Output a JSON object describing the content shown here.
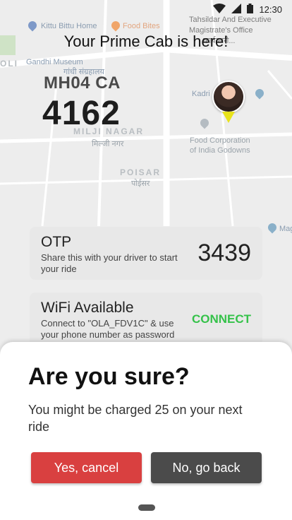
{
  "status_bar": {
    "time": "12:30",
    "icons": [
      "wifi-icon",
      "signal-icon",
      "battery-icon"
    ]
  },
  "map": {
    "labels": {
      "kittu_bittu_home": "Kittu Bittu Home",
      "food_bites": "Food Bites",
      "tahsildar": "Tahsildar And Executive",
      "magistrate": "Magistrate's Office",
      "karyakari": "कार्यकारी...",
      "gandhi_museum": "Gandhi Museum",
      "gandhi_hindi": "गांधी संग्रहालय",
      "oli": "OLI",
      "kadri": "Kadri",
      "milji_nagar": "MILJI NAGAR",
      "milji_hindi": "मिल्जी नगर",
      "poisar": "POISAR",
      "poisar_hindi": "पोईसर",
      "fci_line1": "Food Corporation",
      "fci_line2": "of India Godowns",
      "mag": "Mag"
    }
  },
  "hero": {
    "title": "Your Prime Cab is here!",
    "plate_prefix": "MH04 CA",
    "plate_number": "4162"
  },
  "otp_card": {
    "title": "OTP",
    "subtitle": "Share this with your driver to start your ride",
    "value": "3439"
  },
  "wifi_card": {
    "title": "WiFi Available",
    "subtitle": "Connect to \"OLA_FDV1C\" & use your phone number as password",
    "action": "CONNECT"
  },
  "dialog": {
    "title": "Are you sure?",
    "message": "You might be charged 25 on your next ride",
    "confirm_label": "Yes, cancel",
    "dismiss_label": "No, go back"
  },
  "colors": {
    "confirm": "#d94040",
    "dismiss": "#4b4b4b",
    "connect": "#35c24a",
    "pointer": "#e8e21b"
  }
}
